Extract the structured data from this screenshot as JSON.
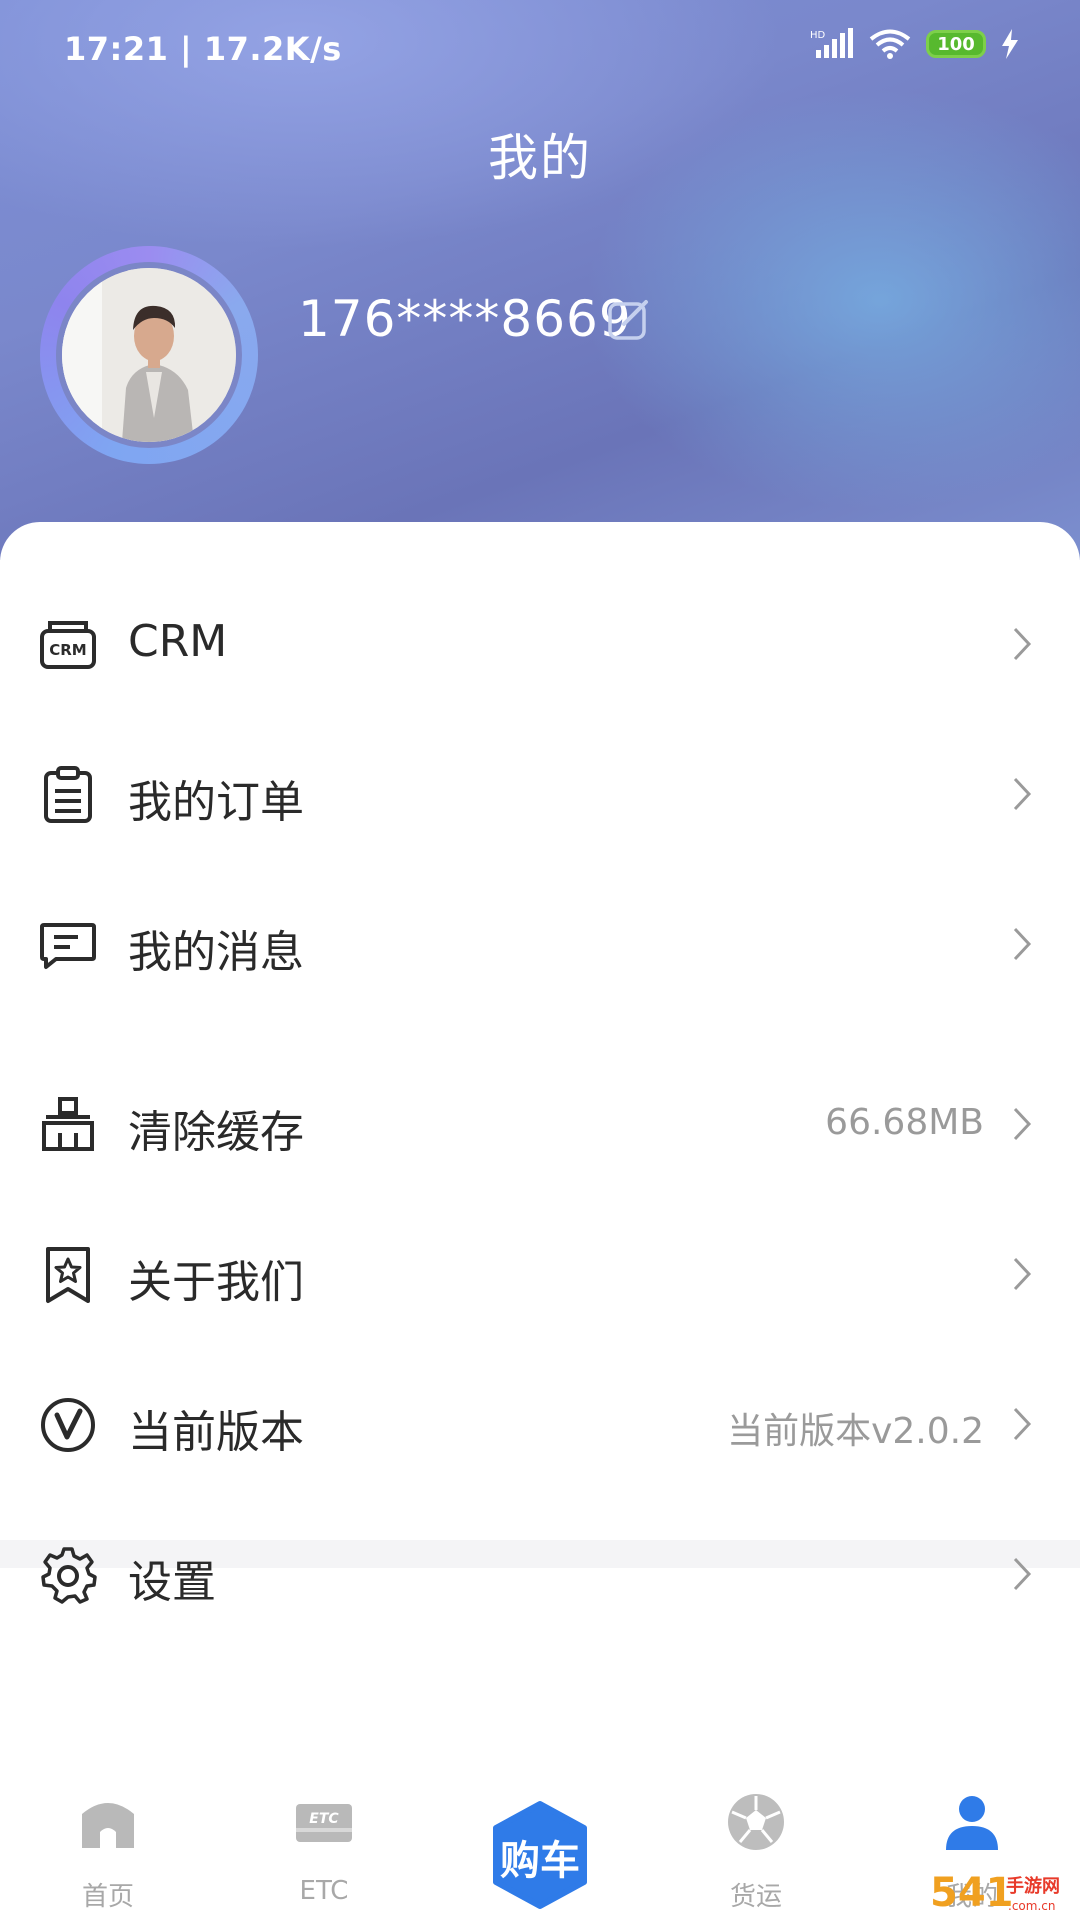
{
  "status_bar": {
    "time": "17:21 | 17.2K/s",
    "battery": "100"
  },
  "header": {
    "title": "我的"
  },
  "profile": {
    "phone": "176****8669"
  },
  "menu": {
    "items": [
      {
        "label": "CRM",
        "value": "",
        "icon": "crm-icon"
      },
      {
        "label": "我的订单",
        "value": "",
        "icon": "clipboard-icon"
      },
      {
        "label": "我的消息",
        "value": "",
        "icon": "message-icon"
      },
      {
        "label": "清除缓存",
        "value": "66.68MB",
        "icon": "broom-icon"
      },
      {
        "label": "关于我们",
        "value": "",
        "icon": "star-bookmark-icon"
      },
      {
        "label": "当前版本",
        "value": "当前版本v2.0.2",
        "icon": "version-icon"
      },
      {
        "label": "设置",
        "value": "",
        "icon": "gear-icon"
      }
    ]
  },
  "tabbar": {
    "items": [
      {
        "label": "首页",
        "icon": "home-icon"
      },
      {
        "label": "ETC",
        "icon": "etc-card-icon"
      },
      {
        "label": "购车",
        "icon": "hexagon-buy-car-icon"
      },
      {
        "label": "货运",
        "icon": "freight-ball-icon"
      },
      {
        "label": "我的",
        "icon": "user-icon"
      }
    ],
    "active_color": "#2f7be8",
    "inactive_color": "#a8a8a8"
  },
  "colors": {
    "accent": "#2f7be8",
    "hero": "#7a88cc"
  }
}
